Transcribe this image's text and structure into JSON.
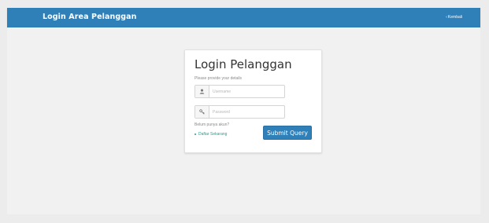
{
  "header": {
    "title": "Login Area Pelanggan",
    "back_label": "Kembali",
    "back_icon": "chevron-left-icon"
  },
  "login": {
    "title": "Login Pelanggan",
    "subtitle": "Please provide your details",
    "username": {
      "placeholder": "Username",
      "value": "",
      "icon": "user-icon"
    },
    "password": {
      "placeholder": "Password",
      "value": "",
      "icon": "key-icon"
    },
    "register_hint": "Belum punya akun?",
    "register_link": "Daftar Sekarang",
    "submit_label": "Submit Query"
  },
  "colors": {
    "accent": "#2f7fb8",
    "background": "#ececec",
    "link": "#2a9d8f"
  }
}
